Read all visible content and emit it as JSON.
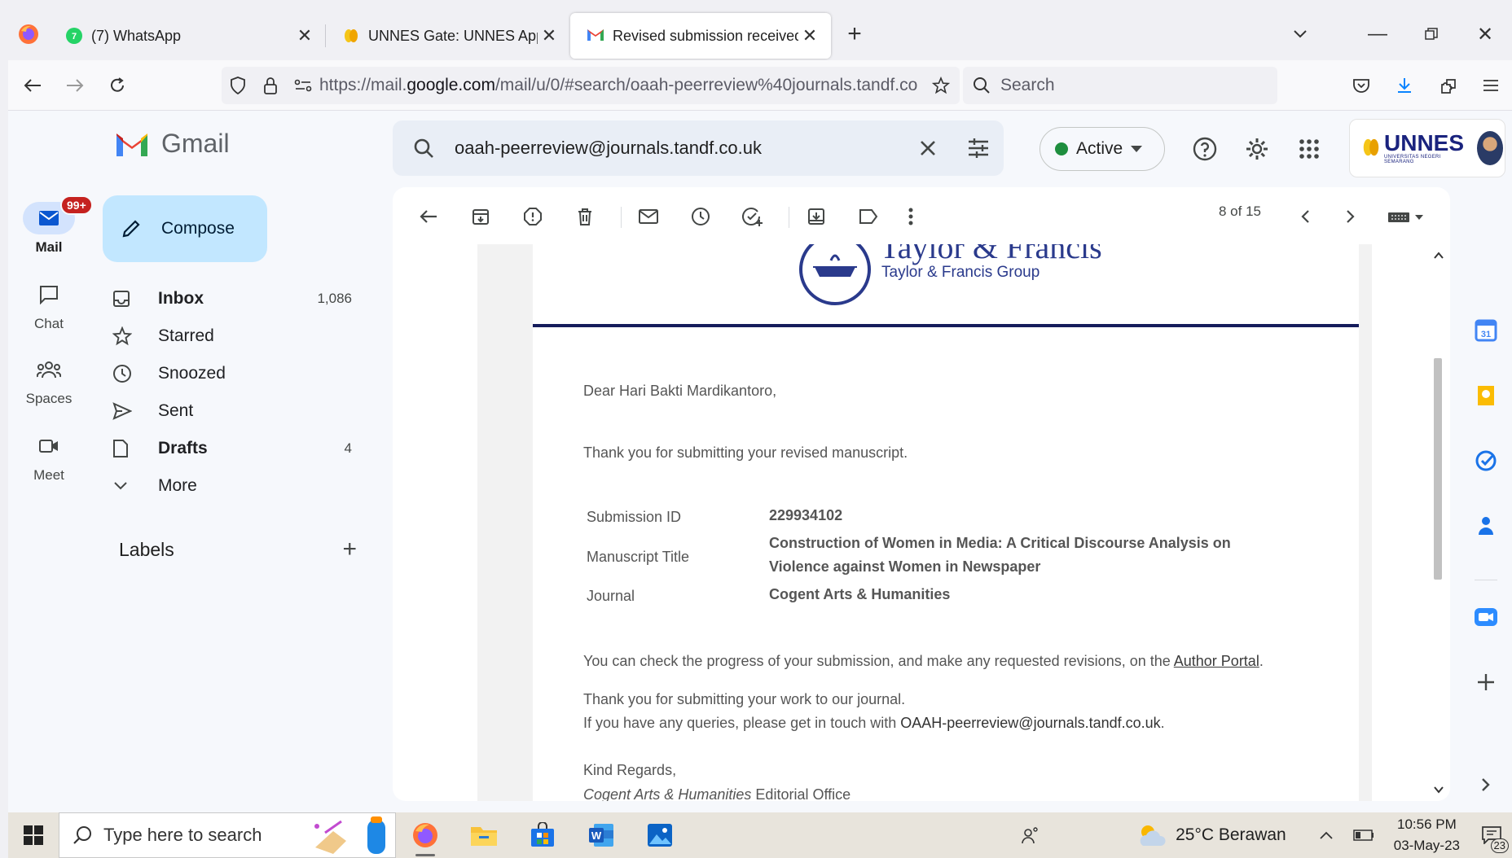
{
  "browser": {
    "tabs": [
      {
        "title": "(7) WhatsApp",
        "icon": "whatsapp-icon"
      },
      {
        "title": "UNNES Gate: UNNES Applicatio",
        "icon": "unnes-icon"
      },
      {
        "title": "Revised submission received for",
        "icon": "gmail-icon",
        "active": true
      }
    ],
    "url_prefix": "https://mail.",
    "url_domain": "google.com",
    "url_path": "/mail/u/0/#search/oaah-peerreview%40journals.tandf.co",
    "search_placeholder": "Search"
  },
  "gmail": {
    "logo_text": "Gmail",
    "search_value": "oaah-peerreview@journals.tandf.co.uk",
    "status": "Active",
    "rail": [
      {
        "label": "Mail",
        "badge": "99+"
      },
      {
        "label": "Chat"
      },
      {
        "label": "Spaces"
      },
      {
        "label": "Meet"
      }
    ],
    "compose_label": "Compose",
    "folders": [
      {
        "label": "Inbox",
        "count": "1,086",
        "bold": true
      },
      {
        "label": "Starred",
        "count": ""
      },
      {
        "label": "Snoozed",
        "count": ""
      },
      {
        "label": "Sent",
        "count": ""
      },
      {
        "label": "Drafts",
        "count": "4",
        "bold": true
      },
      {
        "label": "More",
        "count": ""
      }
    ],
    "labels_heading": "Labels",
    "pager": "8 of 15"
  },
  "account": {
    "org_name": "UNNES",
    "org_sub": "UNIVERSITAS NEGERI SEMARANG"
  },
  "email": {
    "publisher_name": "Taylor & Francis",
    "publisher_group": "Taylor & Francis Group",
    "greeting": "Dear Hari Bakti Mardikantoro,",
    "thanks_line": "Thank you for submitting your revised manuscript.",
    "fields": {
      "submission_id_label": "Submission ID",
      "submission_id": "229934102",
      "title_label": "Manuscript Title",
      "title_line1": "Construction of Women in Media: A Critical Discourse Analysis on",
      "title_line2": "Violence against Women in Newspaper",
      "journal_label": "Journal",
      "journal": "Cogent Arts & Humanities"
    },
    "progress_text": "You can check the progress of your submission, and make any requested revisions, on the ",
    "portal_link": "Author Portal",
    "thanks_work": "Thank you for submitting your work to our journal.",
    "queries_text": "If you have any queries, please get in touch with ",
    "contact_email": "OAAH-peerreview@journals.tandf.co.uk",
    "regards": "Kind Regards,",
    "signature_journal": "Cogent Arts & Humanities",
    "signature_office": " Editorial Office"
  },
  "taskbar": {
    "search_placeholder": "Type here to search",
    "weather": "25°C  Berawan",
    "time": "10:56 PM",
    "date": "03-May-23",
    "notifications": "23"
  }
}
